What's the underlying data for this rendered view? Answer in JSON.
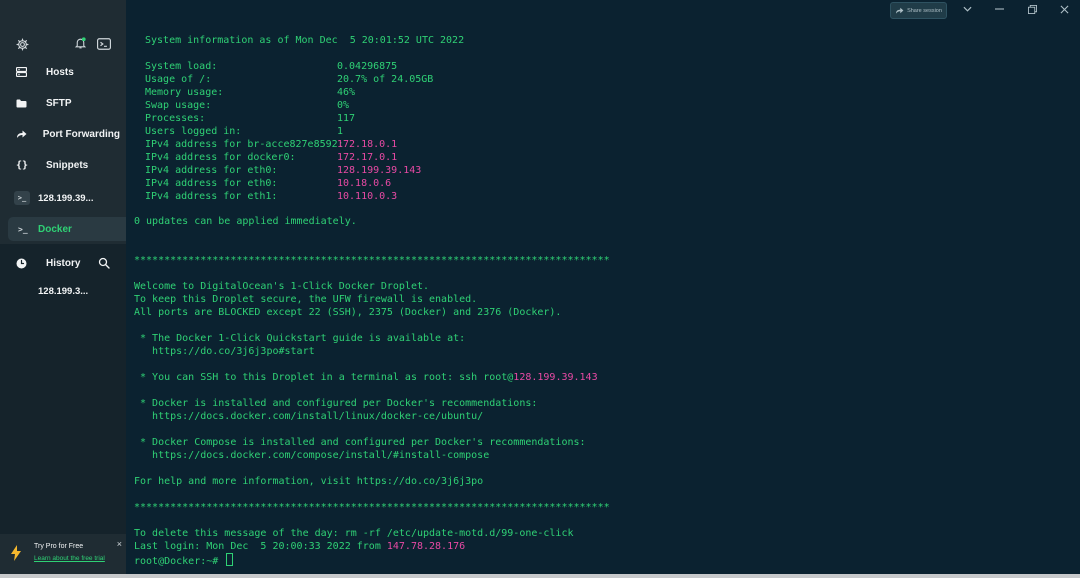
{
  "sidebar": {
    "nav": [
      {
        "label": "Hosts",
        "icon": "hosts-icon"
      },
      {
        "label": "SFTP",
        "icon": "folder-icon"
      },
      {
        "label": "Port Forwarding",
        "icon": "port-forwarding-icon"
      },
      {
        "label": "Snippets",
        "icon": "snippets-icon"
      }
    ],
    "host_session": {
      "label": "128.199.39...",
      "badge": ">_"
    },
    "active_session": {
      "label": "Docker",
      "badge": ">_"
    },
    "history": {
      "label": "History",
      "entries": [
        "128.199.3..."
      ]
    }
  },
  "promo": {
    "title": "Try Pro for Free",
    "link": "Learn about the free trial",
    "close": "×"
  },
  "titlebar": {
    "share_label": "Share session"
  },
  "colors": {
    "accent_green": "#2fd175",
    "highlight_pink": "#e84aa4",
    "terminal_bg": "#0b2230",
    "sidebar_bg": "#1f2c33"
  },
  "terminal": {
    "sysinfo_header": "System information as of Mon Dec  5 20:01:52 UTC 2022",
    "stats": [
      {
        "key": "System load:",
        "value": "0.04296875",
        "highlight": false
      },
      {
        "key": "Usage of /:",
        "value": "20.7% of 24.05GB",
        "highlight": false
      },
      {
        "key": "Memory usage:",
        "value": "46%",
        "highlight": false
      },
      {
        "key": "Swap usage:",
        "value": "0%",
        "highlight": false
      },
      {
        "key": "Processes:",
        "value": "117",
        "highlight": false
      },
      {
        "key": "Users logged in:",
        "value": "1",
        "highlight": false
      },
      {
        "key": "IPv4 address for br-acce827e8592:",
        "value": "172.18.0.1",
        "highlight": true
      },
      {
        "key": "IPv4 address for docker0:",
        "value": "172.17.0.1",
        "highlight": true
      },
      {
        "key": "IPv4 address for eth0:",
        "value": "128.199.39.143",
        "highlight": true
      },
      {
        "key": "IPv4 address for eth0:",
        "value": "10.18.0.6",
        "highlight": true
      },
      {
        "key": "IPv4 address for eth1:",
        "value": "10.110.0.3",
        "highlight": true
      }
    ],
    "updates": "0 updates can be applied immediately.",
    "stars": "*******************************************************************************",
    "welcome": "Welcome to DigitalOcean's 1-Click Docker Droplet.",
    "firewall": "To keep this Droplet secure, the UFW firewall is enabled.",
    "ports": "All ports are BLOCKED except 22 (SSH), 2375 (Docker) and 2376 (Docker).",
    "quickstart": " * The Docker 1-Click Quickstart guide is available at:",
    "quickstart_url": "   https://do.co/3j6j3po#start",
    "ssh_prefix": " * You can SSH to this Droplet in a terminal as root: ssh root@",
    "ssh_ip": "128.199.39.143",
    "docker_installed": " * Docker is installed and configured per Docker's recommendations:",
    "docker_url": "   https://docs.docker.com/install/linux/docker-ce/ubuntu/",
    "compose_installed": " * Docker Compose is installed and configured per Docker's recommendations:",
    "compose_url": "   https://docs.docker.com/compose/install/#install-compose",
    "help": "For help and more information, visit https://do.co/3j6j3po",
    "delete_motd": "To delete this message of the day: rm -rf /etc/update-motd.d/99-one-click",
    "last_login_prefix": "Last login: Mon Dec  5 20:00:33 2022 from ",
    "last_login_ip": "147.78.28.176",
    "prompt": "root@Docker:~# "
  }
}
